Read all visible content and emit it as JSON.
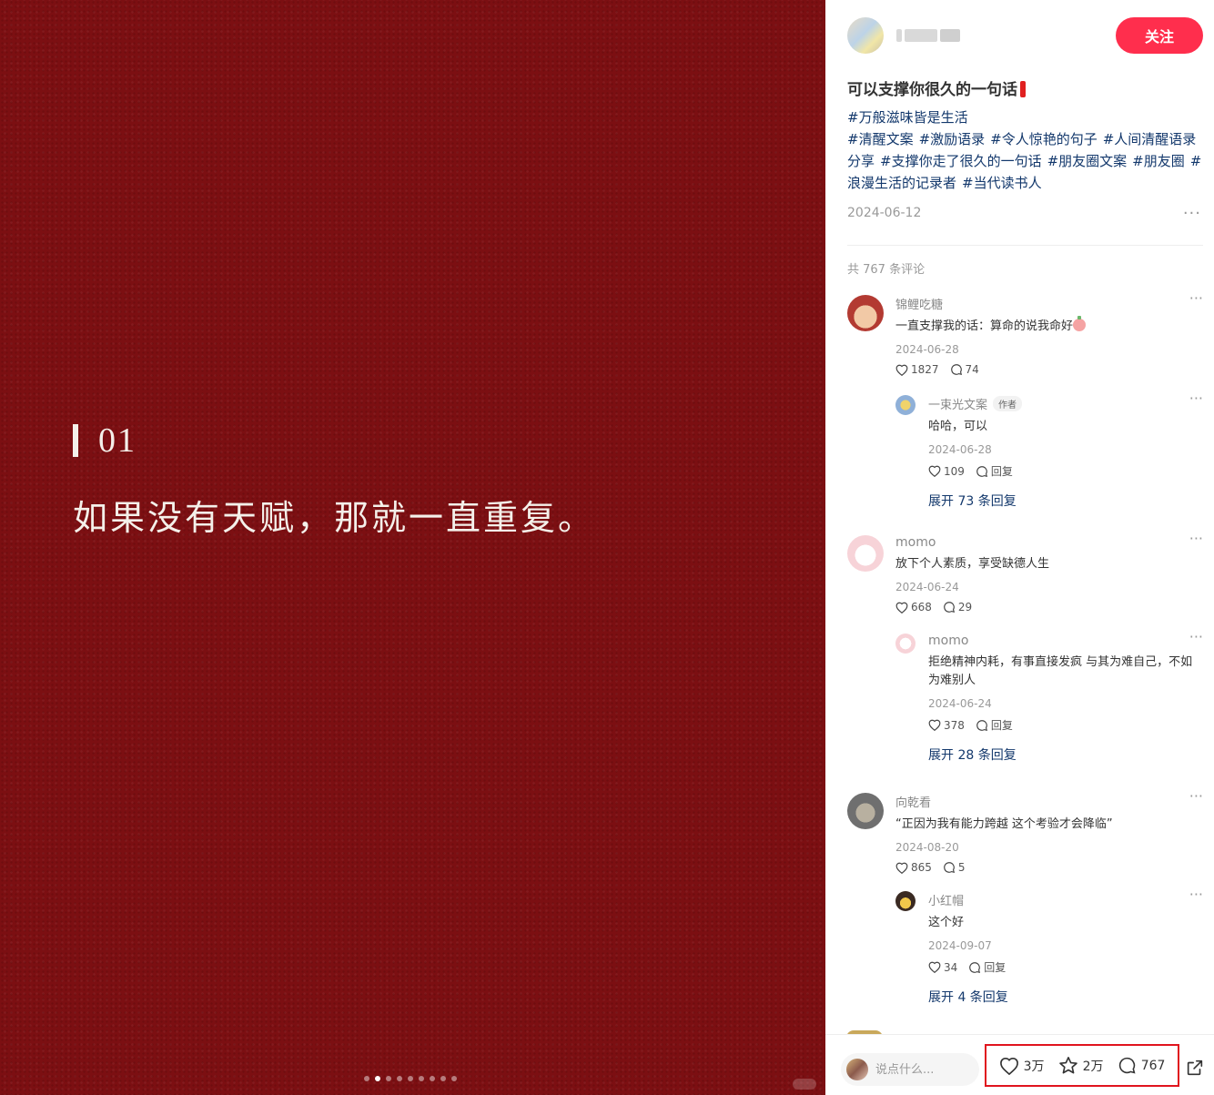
{
  "media": {
    "number": "01",
    "quote": "如果没有天赋，那就一直重复。",
    "carousel": {
      "count": 9,
      "active_index": 1
    }
  },
  "author": {
    "follow_label": "关注"
  },
  "post": {
    "title": "可以支撑你很久的一句话",
    "tags": [
      "#万般滋味皆是生活",
      "#清醒文案",
      "#激励语录",
      "#令人惊艳的句子",
      "#人间清醒语录分享",
      "#支撑你走了很久的一句话",
      "#朋友圈文案",
      "#朋友圈",
      "#浪漫生活的记录者",
      "#当代读书人"
    ],
    "date": "2024-06-12",
    "more": "···"
  },
  "comments_count": "共 767 条评论",
  "comments": [
    {
      "name": "锦鲤吃糖",
      "text": "一直支撑我的话：算命的说我命好",
      "date": "2024-06-28",
      "likes": "1827",
      "replies": "74",
      "reply": {
        "name": "一束光文案",
        "badge": "作者",
        "text": "哈哈，可以",
        "date": "2024-06-28",
        "likes": "109",
        "reply_label": "回复"
      },
      "expand": "展开 73 条回复"
    },
    {
      "name": "momo",
      "text": "放下个人素质，享受缺德人生",
      "date": "2024-06-24",
      "likes": "668",
      "replies": "29",
      "reply": {
        "name": "momo",
        "text": "拒绝精神内耗，有事直接发疯 与其为难自己，不如为难别人",
        "date": "2024-06-24",
        "likes": "378",
        "reply_label": "回复"
      },
      "expand": "展开 28 条回复"
    },
    {
      "name": "向乾看",
      "text": "“正因为我有能力跨越 这个考验才会降临”",
      "date": "2024-08-20",
      "likes": "865",
      "replies": "5",
      "reply": {
        "name": "小红帽",
        "text": "这个好",
        "date": "2024-09-07",
        "likes": "34",
        "reply_label": "回复"
      },
      "expand": "展开 4 条回复"
    }
  ],
  "bottom": {
    "input_placeholder": "说点什么...",
    "likes": "3万",
    "collects": "2万",
    "comments": "767"
  },
  "colors": {
    "accent": "#ff2e4d",
    "tag": "#13386c",
    "image_bg": "#7c0f12",
    "highlight_box": "#e0141e"
  }
}
